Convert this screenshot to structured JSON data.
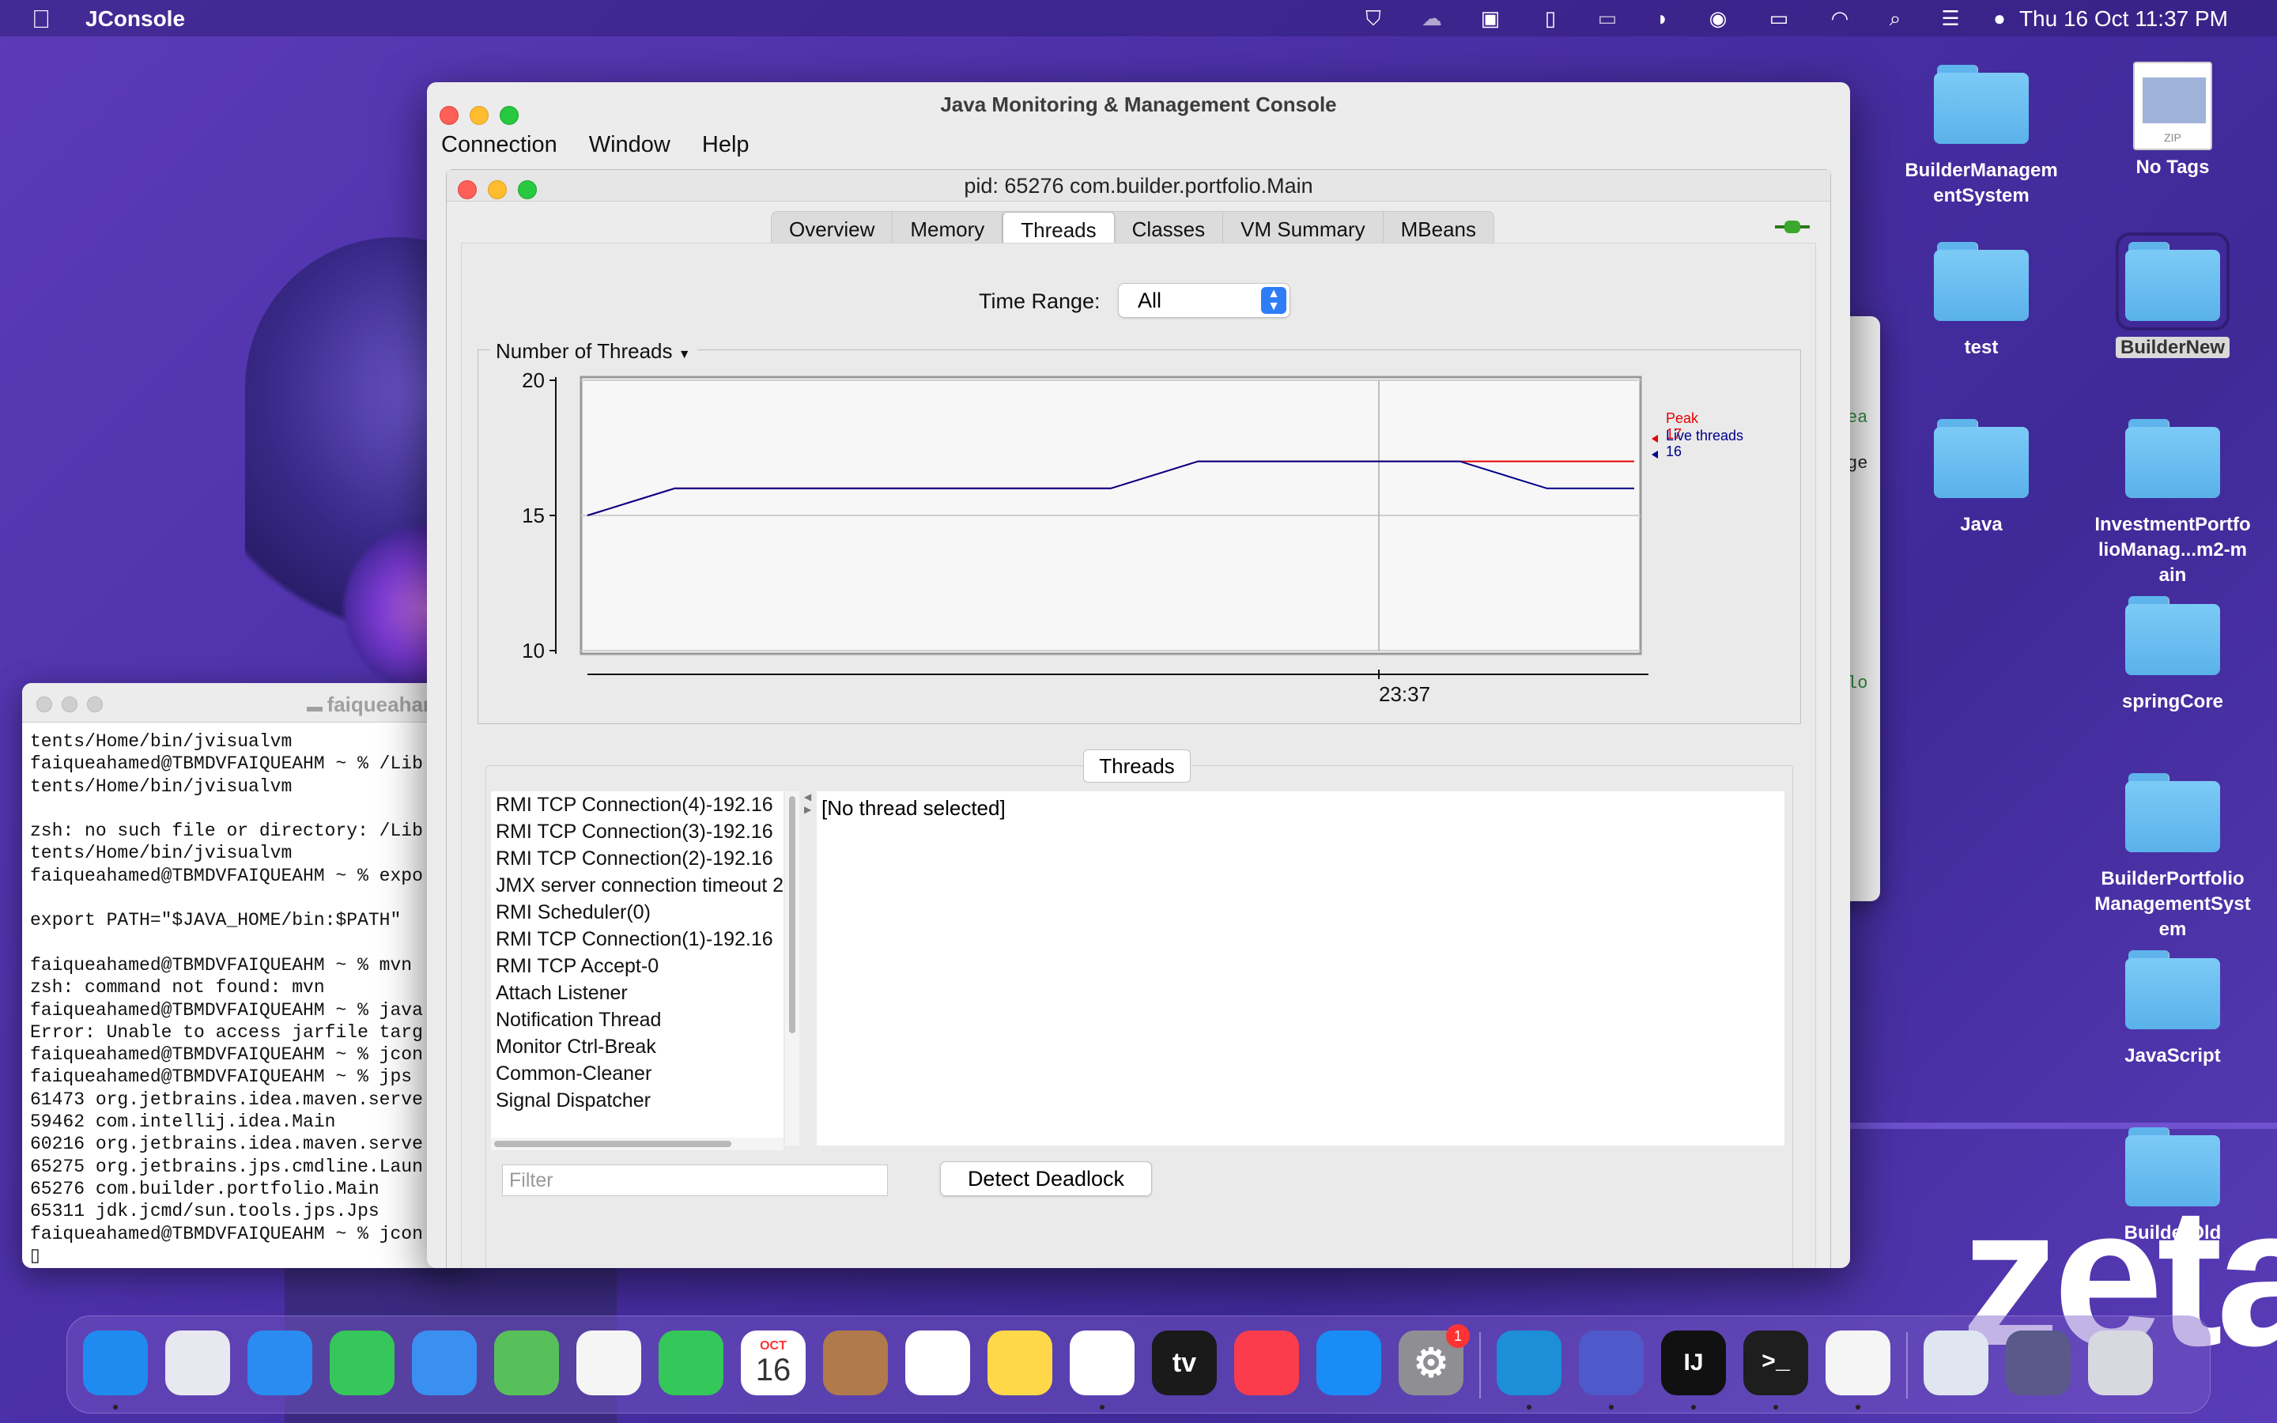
{
  "menubar": {
    "app_name": "JConsole",
    "clock": "Thu 16 Oct  11:37 PM"
  },
  "desktop": {
    "icons": [
      {
        "label": "BuilderManagementSystem",
        "icon": "folder-icon"
      },
      {
        "label": "No Tags",
        "icon": "zip-file-icon"
      },
      {
        "label": "test",
        "icon": "folder-icon"
      },
      {
        "label": "BuilderNew",
        "icon": "folder-icon"
      },
      {
        "label": "Java",
        "icon": "folder-icon"
      },
      {
        "label": "InvestmentPortfolioManag...m2-main",
        "icon": "folder-icon"
      },
      {
        "label": "springCore",
        "icon": "folder-icon"
      },
      {
        "label": "BuilderPortfolioManagementSystem",
        "icon": "folder-icon"
      },
      {
        "label": "JavaScript",
        "icon": "folder-icon"
      },
      {
        "label": "BuilderOld",
        "icon": "folder-icon"
      }
    ],
    "wallpaper_text": "zeta"
  },
  "terminal": {
    "title": "faiqueaham",
    "lines": [
      "tents/Home/bin/jvisualvm",
      "faiqueahamed@TBMDVFAIQUEAHM ~ % /Lib",
      "tents/Home/bin/jvisualvm",
      "",
      "zsh: no such file or directory: /Lib",
      "tents/Home/bin/jvisualvm",
      "faiqueahamed@TBMDVFAIQUEAHM ~ % expo",
      "",
      "export PATH=\"$JAVA_HOME/bin:$PATH\"",
      "",
      "faiqueahamed@TBMDVFAIQUEAHM ~ % mvn",
      "zsh: command not found: mvn",
      "faiqueahamed@TBMDVFAIQUEAHM ~ % java",
      "Error: Unable to access jarfile targ",
      "faiqueahamed@TBMDVFAIQUEAHM ~ % jcon",
      "faiqueahamed@TBMDVFAIQUEAHM ~ % jps",
      "61473 org.jetbrains.idea.maven.serve",
      "59462 com.intellij.idea.Main",
      "60216 org.jetbrains.idea.maven.serve",
      "65275 org.jetbrains.jps.cmdline.Laun",
      "65276 com.builder.portfolio.Main",
      "65311 jdk.jcmd/sun.tools.jps.Jps",
      "faiqueahamed@TBMDVFAIQUEAHM ~ % jcon",
      "▯"
    ]
  },
  "backwin": {
    "snippets": [
      "ea",
      "ge",
      "lo"
    ]
  },
  "window": {
    "title": "Java Monitoring & Management Console",
    "menu": [
      "Connection",
      "Window",
      "Help"
    ],
    "inner_title": "pid: 65276 com.builder.portfolio.Main",
    "tabs": [
      "Overview",
      "Memory",
      "Threads",
      "Classes",
      "VM Summary",
      "MBeans"
    ],
    "active_tab": "Threads",
    "time_range_label": "Time Range:",
    "time_range_value": "All",
    "chart_title": "Number of Threads",
    "threads_section_label": "Threads",
    "thread_list": [
      "RMI TCP Connection(4)-192.16",
      "RMI TCP Connection(3)-192.16",
      "RMI TCP Connection(2)-192.16",
      "JMX server connection timeout 2",
      "RMI Scheduler(0)",
      "RMI TCP Connection(1)-192.16",
      "RMI TCP Accept-0",
      "Attach Listener",
      "Notification Thread",
      "Monitor Ctrl-Break",
      "Common-Cleaner",
      "Signal Dispatcher"
    ],
    "detail_text": "[No thread selected]",
    "filter_placeholder": "Filter",
    "detect_deadlock_label": "Detect Deadlock"
  },
  "chart_data": {
    "type": "line",
    "title": "Number of Threads",
    "ylim": [
      10,
      20
    ],
    "yticks": [
      10,
      15,
      20
    ],
    "xtick_labels": [
      "23:37"
    ],
    "legend_placement": "right",
    "grid": true,
    "series": [
      {
        "name": "Peak",
        "color": "#e60000",
        "latest": 17,
        "values": [
          15,
          16,
          16,
          16,
          16,
          16,
          16,
          17,
          17,
          17,
          17,
          17,
          17
        ]
      },
      {
        "name": "Live threads",
        "color": "#00008b",
        "latest": 16,
        "values": [
          15,
          16,
          16,
          16,
          16,
          16,
          16,
          17,
          17,
          17,
          17,
          16,
          16
        ]
      }
    ]
  },
  "dock": {
    "apps": [
      {
        "name": "finder-icon",
        "color": "#1f8bf0"
      },
      {
        "name": "launchpad-icon",
        "color": "#e8e8f0"
      },
      {
        "name": "safari-icon",
        "color": "#2a8cf0"
      },
      {
        "name": "messages-icon",
        "color": "#35c759"
      },
      {
        "name": "mail-icon",
        "color": "#3a90f0"
      },
      {
        "name": "maps-icon",
        "color": "#58c05a"
      },
      {
        "name": "photos-icon",
        "color": "#f5f5f5"
      },
      {
        "name": "facetime-icon",
        "color": "#34c759"
      },
      {
        "name": "calendar-icon",
        "color": "#ffffff"
      },
      {
        "name": "contacts-icon",
        "color": "#b07a4a"
      },
      {
        "name": "reminders-icon",
        "color": "#ffffff"
      },
      {
        "name": "notes-icon",
        "color": "#ffd84a"
      },
      {
        "name": "freeform-icon",
        "color": "#ffffff"
      },
      {
        "name": "appletv-icon",
        "color": "#1a1a1a"
      },
      {
        "name": "music-icon",
        "color": "#fa3c4c"
      },
      {
        "name": "appstore-icon",
        "color": "#1a8cf5"
      },
      {
        "name": "system-settings-icon",
        "color": "#8e8e93"
      },
      {
        "name": "edge-icon",
        "color": "#1d8ed8"
      },
      {
        "name": "teams-icon",
        "color": "#5059c9"
      },
      {
        "name": "intellij-icon",
        "color": "#111111"
      },
      {
        "name": "terminal-icon",
        "color": "#1e1e1e"
      },
      {
        "name": "java-icon",
        "color": "#f5f5f5"
      },
      {
        "name": "archive-icon",
        "color": "#dfe6f0"
      },
      {
        "name": "support-icon",
        "color": "#5a5a8a"
      },
      {
        "name": "trash-icon",
        "color": "#d8d8e0"
      }
    ],
    "calendar_month": "OCT",
    "calendar_day": "16",
    "settings_badge": "1",
    "appletv_label": "tv",
    "intellij_label": "IJ",
    "terminal_label": ">_"
  }
}
